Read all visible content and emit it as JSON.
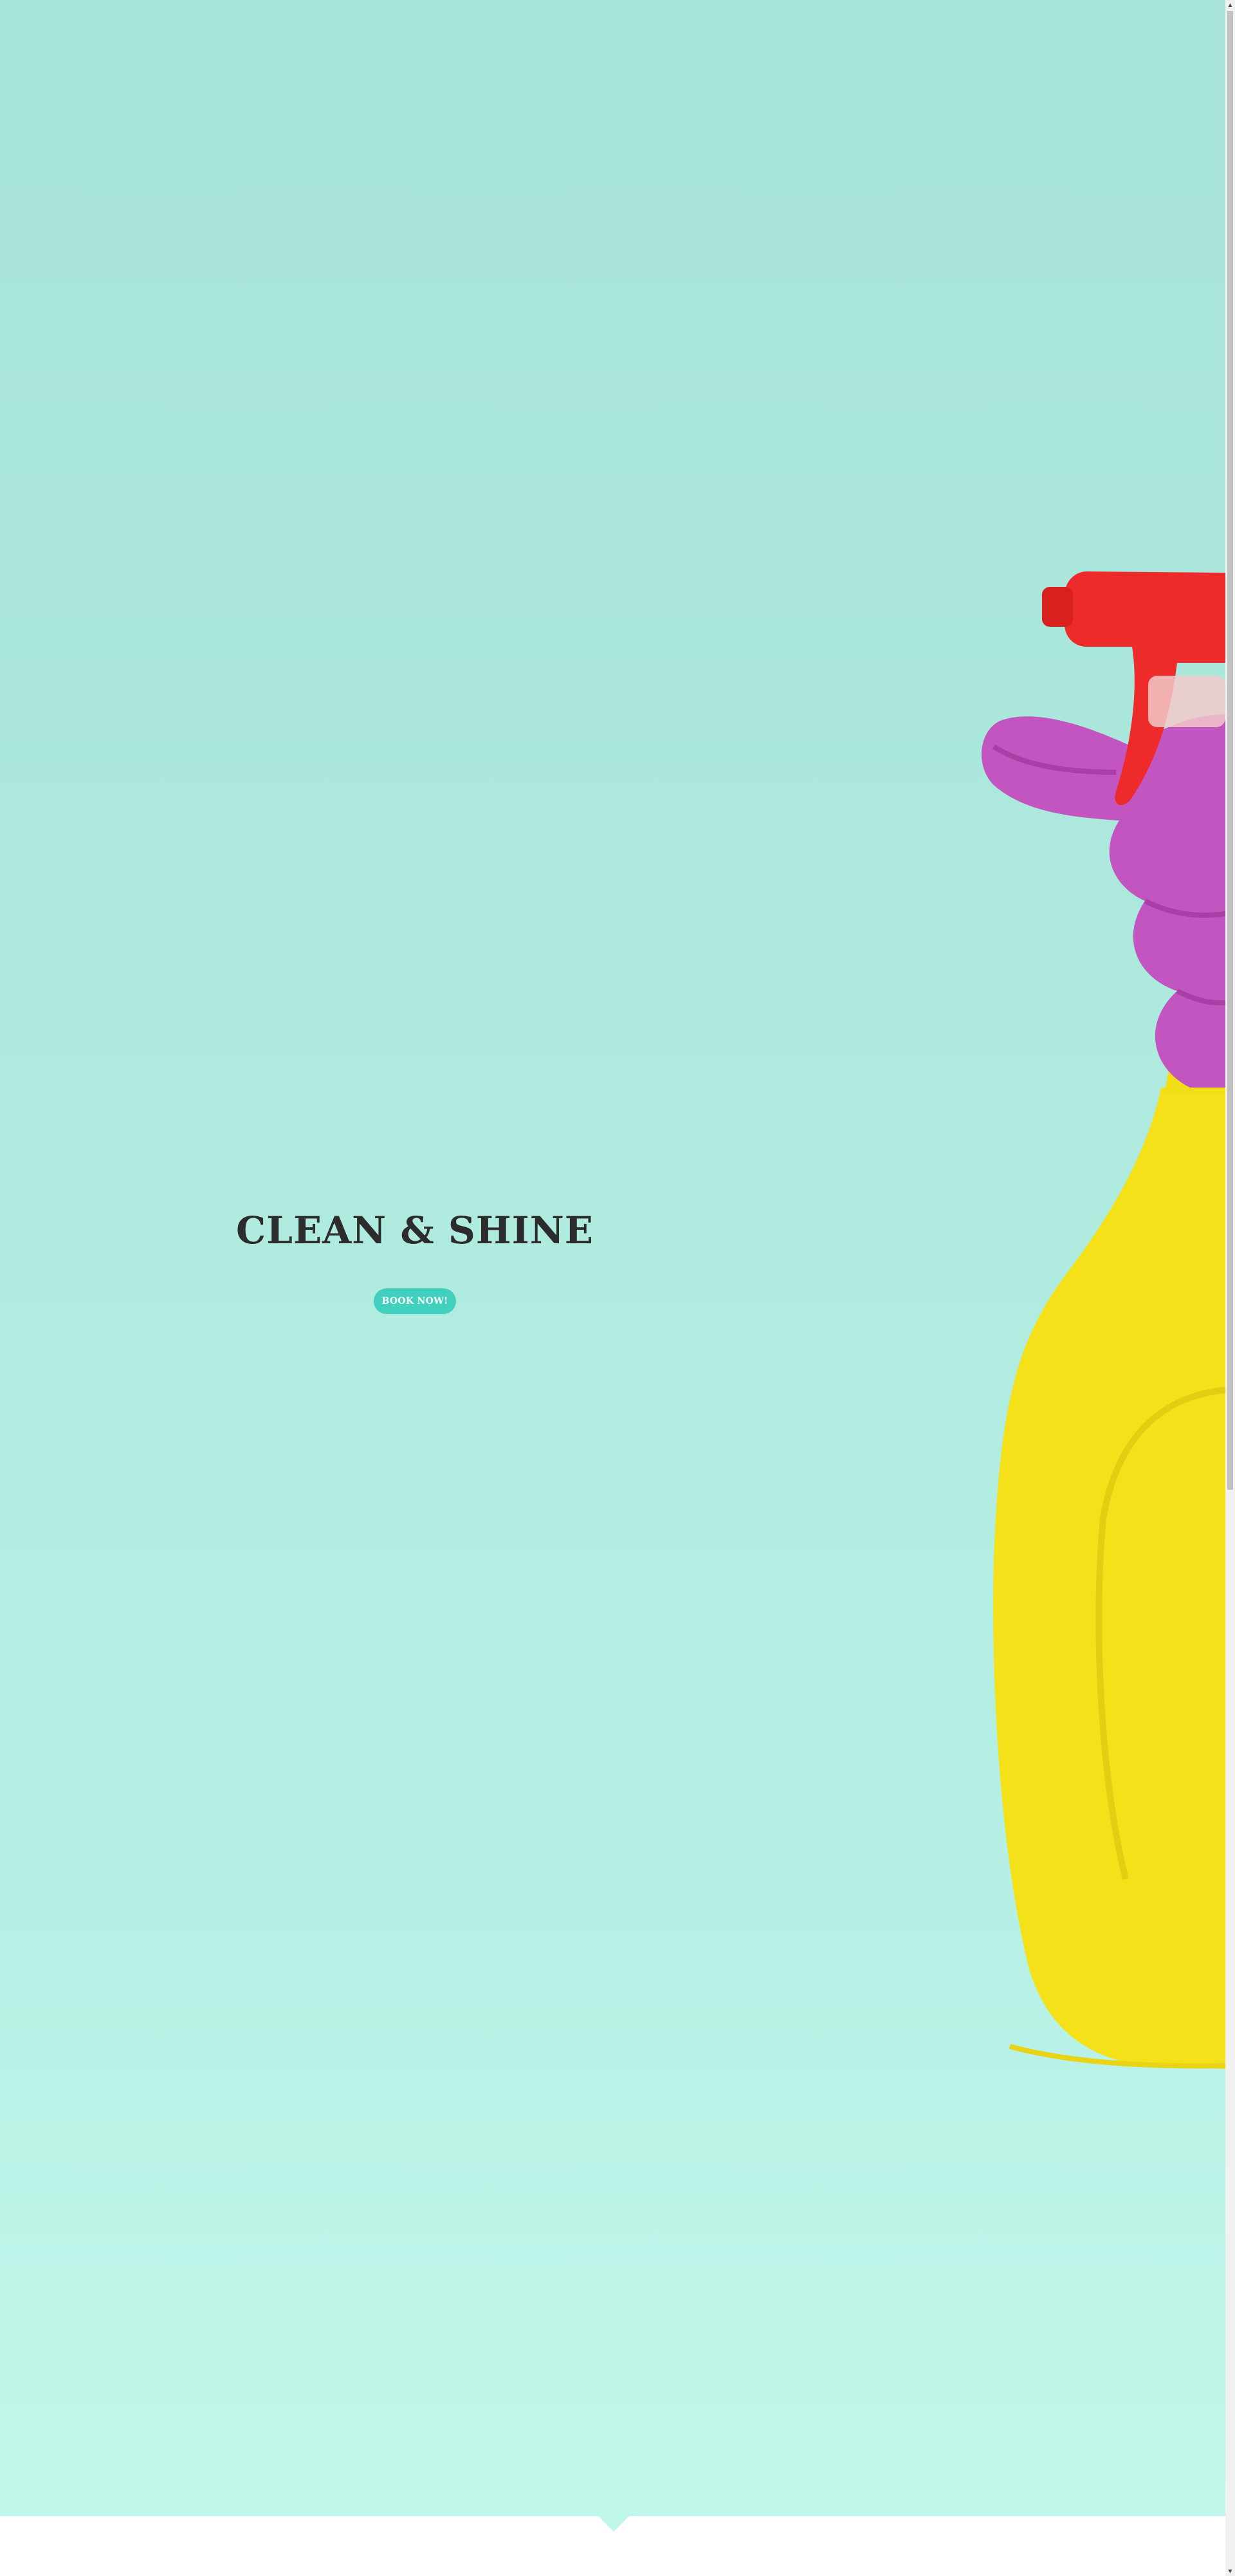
{
  "hero": {
    "title": "CLEAN & SHINE",
    "cta_label": "BOOK NOW!",
    "image": "hand-in-purple-glove-holding-yellow-spray-bottle"
  },
  "colors": {
    "hero_background": "#a6e3d8",
    "accent": "#40d0bd",
    "title_text": "#2c2c2c",
    "page_background": "#ffffff"
  },
  "icons": {
    "scroll_up": "scroll-up-icon",
    "scroll_down": "scroll-down-icon"
  }
}
